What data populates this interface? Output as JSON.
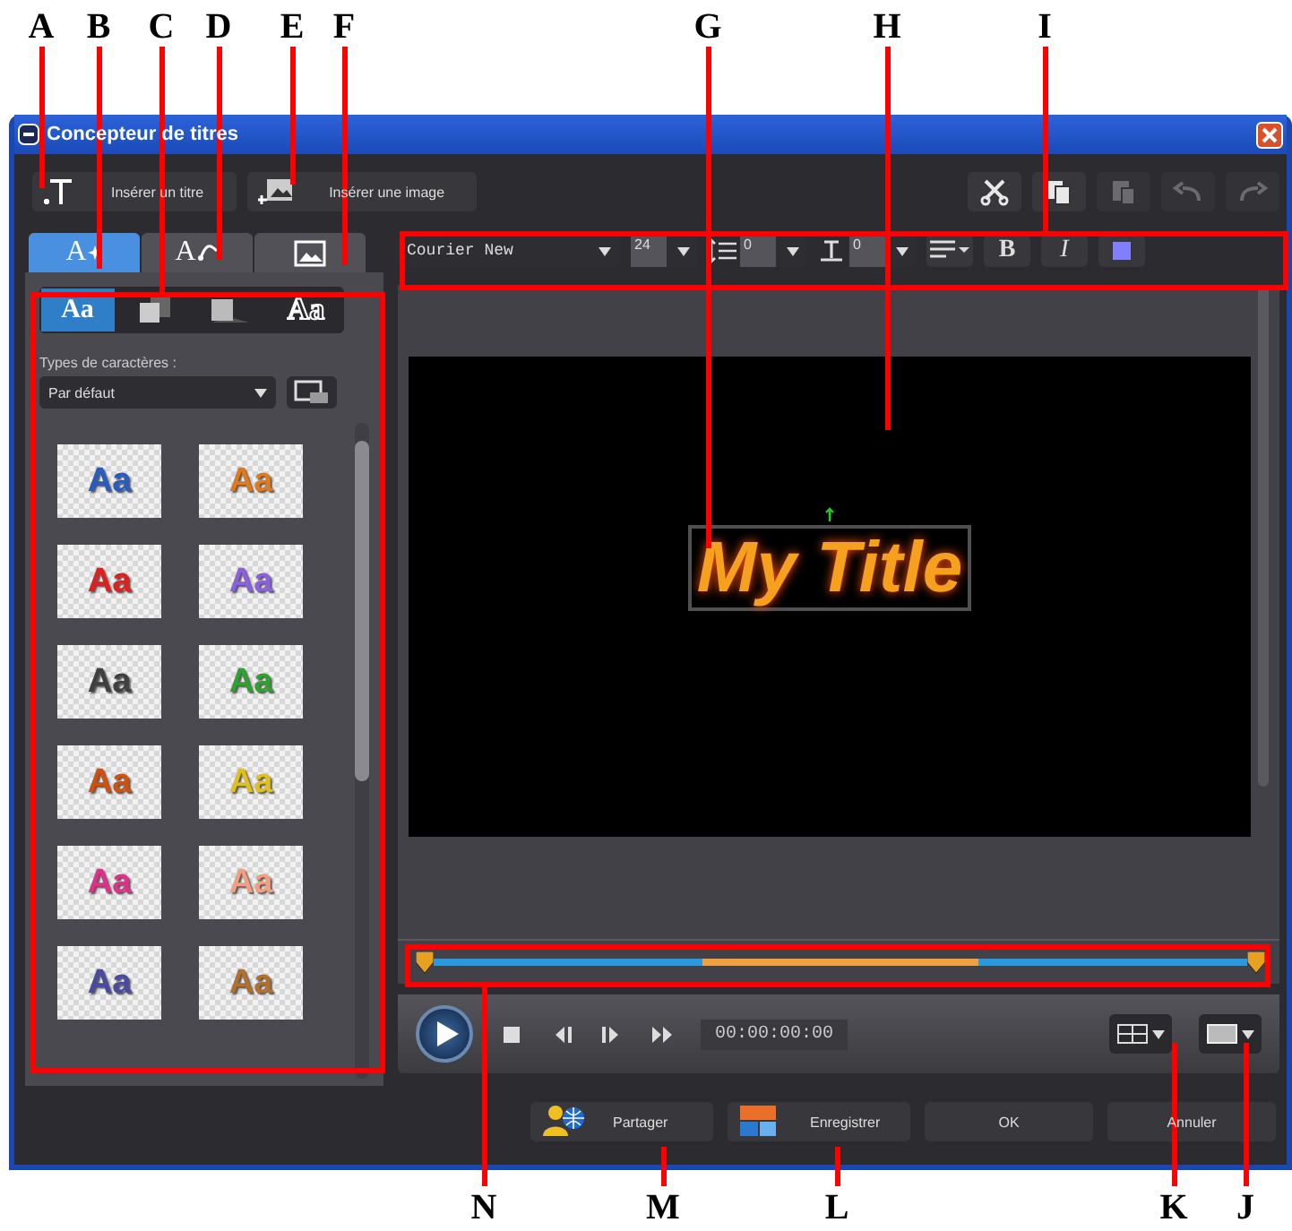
{
  "callouts_top": [
    "A",
    "B",
    "C",
    "D",
    "E",
    "F",
    "G",
    "H",
    "I"
  ],
  "callouts_bottom": [
    "N",
    "M",
    "L",
    "K",
    "J"
  ],
  "window": {
    "title": "Concepteur de titres"
  },
  "toolbar": {
    "insert_title": "Insérer un titre",
    "insert_image": "Insérer une image",
    "edit_tools": [
      {
        "kind": "cut",
        "disabled": false
      },
      {
        "kind": "copy",
        "disabled": false
      },
      {
        "kind": "paste",
        "disabled": true
      },
      {
        "kind": "undo",
        "disabled": true
      },
      {
        "kind": "redo",
        "disabled": true
      }
    ]
  },
  "tabs": [
    {
      "kind": "character",
      "label": "A",
      "selected": true
    },
    {
      "kind": "motion",
      "label": "A",
      "selected": false
    },
    {
      "kind": "background",
      "selected": false
    }
  ],
  "subtabs": [
    {
      "kind": "text",
      "label": "Aa",
      "selected": true
    },
    {
      "kind": "shadow",
      "selected": false
    },
    {
      "kind": "fill",
      "selected": false
    },
    {
      "kind": "outline",
      "label": "Aa",
      "selected": false
    }
  ],
  "font_types": {
    "label": "Types de caractères :",
    "value": "Par défaut"
  },
  "styles": [
    {
      "label": "Aa",
      "color": "#2a5cc0"
    },
    {
      "label": "Aa",
      "color": "#e07a20"
    },
    {
      "label": "Aa",
      "color": "#e02020"
    },
    {
      "label": "Aa",
      "color": "#8a60e0"
    },
    {
      "label": "Aa",
      "color": "#404040"
    },
    {
      "label": "Aa",
      "color": "#30a030"
    },
    {
      "label": "Aa",
      "color": "#d05010"
    },
    {
      "label": "Aa",
      "color": "#e0c020"
    },
    {
      "label": "Aa",
      "color": "#e0308a"
    },
    {
      "label": "Aa",
      "color": "#f0a080"
    },
    {
      "label": "Aa",
      "color": "#4a4aa0"
    },
    {
      "label": "Aa",
      "color": "#b07030"
    }
  ],
  "format": {
    "font": "Courier New",
    "size": "24",
    "line_spacing": "0",
    "kerning": "0",
    "bold": "B",
    "italic": "I",
    "color": "#8080ff"
  },
  "preview": {
    "title": "My Title"
  },
  "player": {
    "timecode": "00:00:00:00"
  },
  "buttons": [
    {
      "kind": "share",
      "label": "Partager"
    },
    {
      "kind": "save",
      "label": "Enregistrer"
    },
    {
      "kind": "plain",
      "label": "OK"
    },
    {
      "kind": "plain",
      "label": "Annuler"
    }
  ]
}
